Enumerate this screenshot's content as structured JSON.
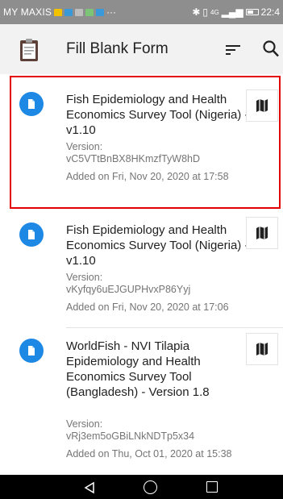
{
  "status_bar": {
    "carrier": "MY MAXIS",
    "overflow": "···",
    "network": "4G",
    "time": "22:4"
  },
  "app_bar": {
    "title": "Fill Blank Form",
    "icons": [
      "clipboard-icon",
      "sort-icon",
      "search-icon"
    ]
  },
  "forms": [
    {
      "title": "Fish Epidemiology and Health Economics Survey Tool (Nigeria) - v1.10",
      "version_label": "Version:",
      "version": "vC5VTtBnBX8HKmzfTyW8hD",
      "added": "Added on Fri, Nov 20, 2020 at 17:58",
      "selected": true
    },
    {
      "title": "Fish Epidemiology and Health Economics Survey Tool (Nigeria) - v1.10",
      "version_label": "Version:",
      "version": "vKyfqy6uEJGUPHvxP86Yyj",
      "added": "Added on Fri, Nov 20, 2020 at 17:06",
      "selected": false
    },
    {
      "title": "WorldFish - NVI Tilapia Epidemiology and Health Economics Survey Tool (Bangladesh) - Version 1.8",
      "version_label": "Version:",
      "version": "vRj3em5oGBiLNkNDTp5x34",
      "added": "Added on Thu, Oct 01, 2020 at 15:38",
      "selected": false
    }
  ],
  "colors": {
    "accent": "#1e88e5",
    "highlight": "#e30000",
    "app_bar_bg": "#f2f2f2",
    "status_bar_bg": "#8e8e8e",
    "nav_bar_bg": "#000000"
  },
  "nav_bar": {
    "icons": [
      "back-icon",
      "home-icon",
      "recent-apps-icon"
    ]
  }
}
